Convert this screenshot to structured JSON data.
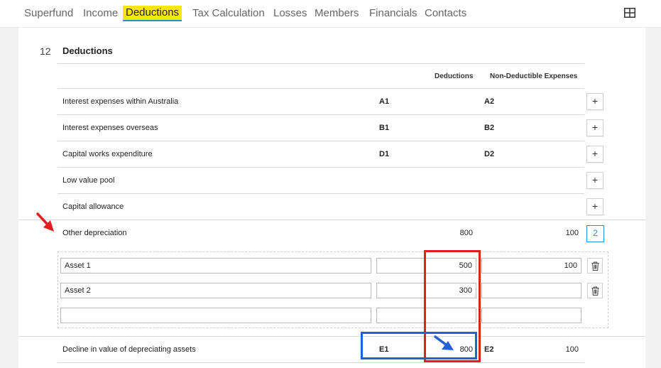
{
  "tabs": [
    {
      "label": "Superfund"
    },
    {
      "label": "Income"
    },
    {
      "label": "Deductions"
    },
    {
      "label": "Tax Calculation"
    },
    {
      "label": "Losses"
    },
    {
      "label": "Members"
    },
    {
      "label": "Financials"
    },
    {
      "label": "Contacts"
    }
  ],
  "active_tab": "Deductions",
  "section": {
    "number": "12",
    "title": "Deductions"
  },
  "columns": {
    "deductions": "Deductions",
    "non_deductible": "Non-Deductible Expenses"
  },
  "rows": [
    {
      "label": "Interest expenses within Australia",
      "code1": "A1",
      "code2": "A2",
      "button": "+"
    },
    {
      "label": "Interest expenses overseas",
      "code1": "B1",
      "code2": "B2",
      "button": "+"
    },
    {
      "label": "Capital works expenditure",
      "code1": "D1",
      "code2": "D2",
      "button": "+"
    },
    {
      "label": "Low value pool",
      "button": "+"
    },
    {
      "label": "Capital allowance",
      "button": "+"
    }
  ],
  "other_depreciation": {
    "label": "Other depreciation",
    "deductions": "800",
    "non_deductible": "100",
    "count": "2"
  },
  "assets": [
    {
      "name": "Asset 1",
      "deductions": "500",
      "non_deductible": "100"
    },
    {
      "name": "Asset 2",
      "deductions": "300",
      "non_deductible": ""
    },
    {
      "name": "",
      "deductions": "",
      "non_deductible": ""
    }
  ],
  "decline_row": {
    "label": "Decline in value of depreciating assets",
    "code1": "E1",
    "deductions": "800",
    "code2": "E2",
    "non_deductible": "100"
  },
  "colors": {
    "accent": "#2a8cd0",
    "active_tab_bg": "#ffe800",
    "highlight_red": "#e02020",
    "highlight_blue": "#2160d8"
  },
  "icons": {
    "layout": "grid-icon",
    "delete": "trash-icon",
    "annotation": "arrow-icon"
  }
}
